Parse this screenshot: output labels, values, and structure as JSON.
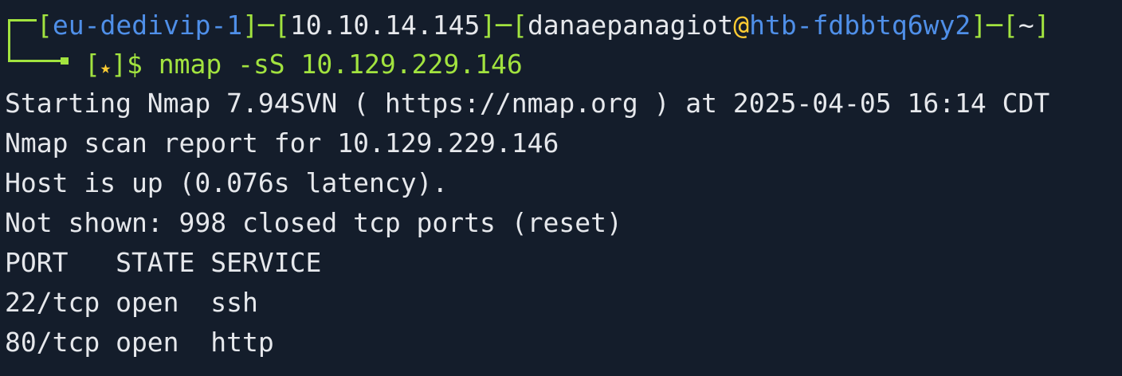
{
  "prompt": {
    "vpn": "eu-dedivip-1",
    "ip": "10.10.14.145",
    "user": "danaepanagiot",
    "at": "@",
    "host": "htb-fdbbtq6wy2",
    "cwd": "~",
    "star": "★",
    "dollar": "]$ ",
    "command": "nmap -sS 10.129.229.146"
  },
  "output": [
    "Starting Nmap 7.94SVN ( https://nmap.org ) at 2025-04-05 16:14 CDT",
    "Nmap scan report for 10.129.229.146",
    "Host is up (0.076s latency).",
    "Not shown: 998 closed tcp ports (reset)",
    "PORT   STATE SERVICE",
    "22/tcp open  ssh",
    "80/tcp open  http"
  ],
  "colors": {
    "background": "#141d2b",
    "green": "#a2e33f",
    "blue": "#4f8fe8",
    "yellow": "#ffcc33",
    "text": "#e6e8ec"
  }
}
